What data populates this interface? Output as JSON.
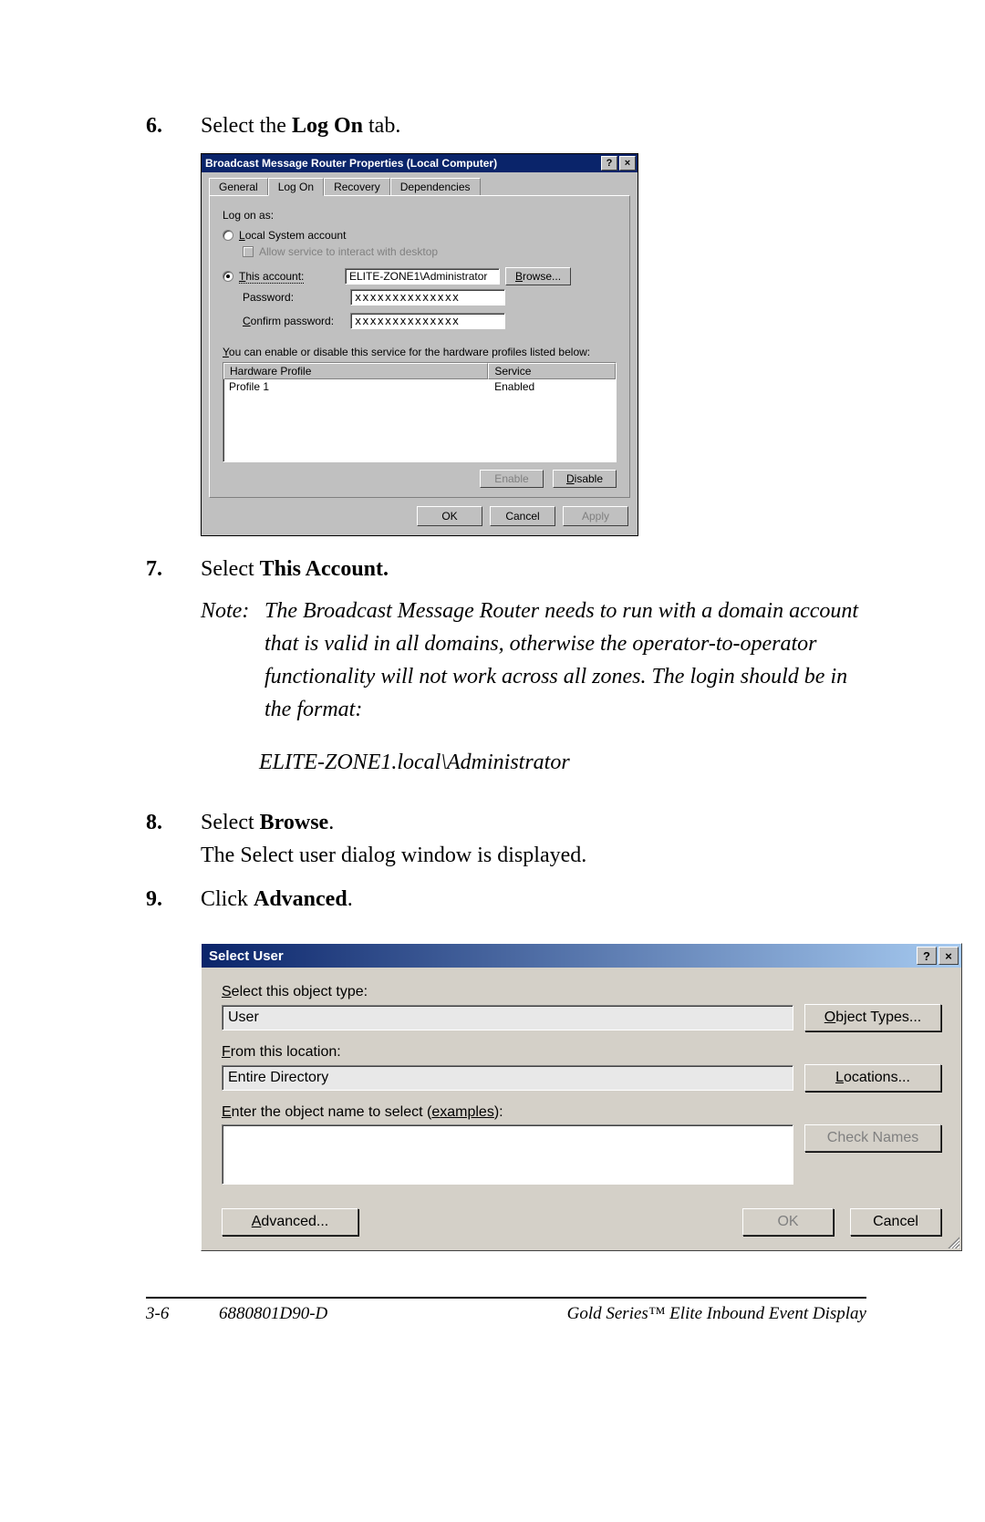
{
  "steps": {
    "s6": {
      "num": "6.",
      "pre": "Select the ",
      "bold": "Log On",
      "post": " tab."
    },
    "s7": {
      "num": "7.",
      "pre": "Select ",
      "bold": "This Account."
    },
    "note": {
      "label": "Note:",
      "text": "The Broadcast Message Router needs to run with a domain account that is valid in all domains, otherwise the operator-to-operator functionality will not work across all zones. The login should be in the format:",
      "line2": "ELITE-ZONE1.local\\Administrator"
    },
    "s8": {
      "num": "8.",
      "pre": "Select ",
      "bold": "Browse",
      "post2": ".",
      "line2": "The Select user dialog window is displayed."
    },
    "s9": {
      "num": "9.",
      "pre": "Click ",
      "bold": "Advanced",
      "post2": "."
    }
  },
  "dlg1": {
    "title": "Broadcast Message Router Properties (Local Computer)",
    "tabs": {
      "general": "General",
      "logon": "Log On",
      "recovery": "Recovery",
      "deps": "Dependencies"
    },
    "logonas": "Log on as:",
    "localsys_pre": "L",
    "localsys_post": "ocal System account",
    "allowdesk": "Allow service to interact with desktop",
    "thisacct_pre": "T",
    "thisacct_post": "his account:",
    "acct_value": "ELITE-ZONE1\\Administrator",
    "browse_pre": "B",
    "browse_post": "rowse...",
    "password": "Password:",
    "confirm_pre": "C",
    "confirm_post": "onfirm password:",
    "pw_value": "xxxxxxxxxxxxxx",
    "hw_desc_pre": "Y",
    "hw_desc_post": "ou can enable or disable this service for the hardware profiles listed below:",
    "hw_col1": "Hardware Profile",
    "hw_col2": "Service",
    "hw_row1_c1": "Profile 1",
    "hw_row1_c2": "Enabled",
    "enable_pre": "E",
    "enable_post": "nable",
    "disable_pre": "D",
    "disable_post": "isable",
    "ok": "OK",
    "cancel": "Cancel",
    "apply_pre": "A",
    "apply_post": "pply"
  },
  "dlg2": {
    "title": "Select User",
    "obj_type_lbl_pre": "S",
    "obj_type_lbl_post": "elect this object type:",
    "obj_type_val": "User",
    "obj_types_btn_pre": "O",
    "obj_types_btn_post": "bject Types...",
    "loc_lbl_pre": "F",
    "loc_lbl_post": "rom this location:",
    "loc_val": "Entire Directory",
    "loc_btn_pre": "L",
    "loc_btn_post": "ocations...",
    "name_lbl_pre": "E",
    "name_lbl_post": "nter the object name to select (",
    "name_lbl_ex_pre": "e",
    "name_lbl_ex_post": "xamples",
    "name_lbl_close": "):",
    "check_btn_pre": "C",
    "check_btn_post": "heck Names",
    "adv_btn_pre": "A",
    "adv_btn_post": "dvanced...",
    "ok": "OK",
    "cancel": "Cancel"
  },
  "footer": {
    "page": "3-6",
    "doc": "6880801D90-D",
    "product": "Gold Series™ Elite Inbound Event Display"
  }
}
